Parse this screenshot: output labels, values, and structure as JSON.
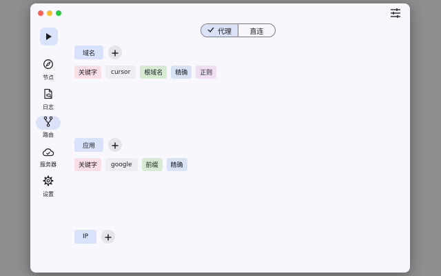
{
  "toolbar": {
    "mode_options": [
      {
        "label": "代理",
        "selected": true
      },
      {
        "label": "直连",
        "selected": false
      }
    ]
  },
  "sidebar": {
    "items": [
      {
        "label": "节点",
        "icon": "compass-icon"
      },
      {
        "label": "日志",
        "icon": "log-search-icon"
      },
      {
        "label": "路由",
        "icon": "route-fork-icon",
        "active": true
      },
      {
        "label": "服务器",
        "icon": "cloud-check-icon"
      },
      {
        "label": "设置",
        "icon": "gear-icon"
      }
    ]
  },
  "sections": [
    {
      "title": "域名",
      "chips": [
        {
          "label": "关键字",
          "color": "#fbdfe6"
        },
        {
          "label": "cursor",
          "color": "#eeeef2"
        },
        {
          "label": "根域名",
          "color": "#d7ebd3"
        },
        {
          "label": "精确",
          "color": "#d8e2f5"
        },
        {
          "label": "正则",
          "color": "#f0dff2"
        }
      ]
    },
    {
      "title": "应用",
      "chips": [
        {
          "label": "关键字",
          "color": "#fbdfe6"
        },
        {
          "label": "google",
          "color": "#eeeef2"
        },
        {
          "label": "前缀",
          "color": "#d7ebd3"
        },
        {
          "label": "精确",
          "color": "#d8e2f5"
        }
      ]
    },
    {
      "title": "IP",
      "chips": []
    }
  ],
  "colors": {
    "accent": "#d8e2fb",
    "window_bg": "#f8f7fd"
  }
}
